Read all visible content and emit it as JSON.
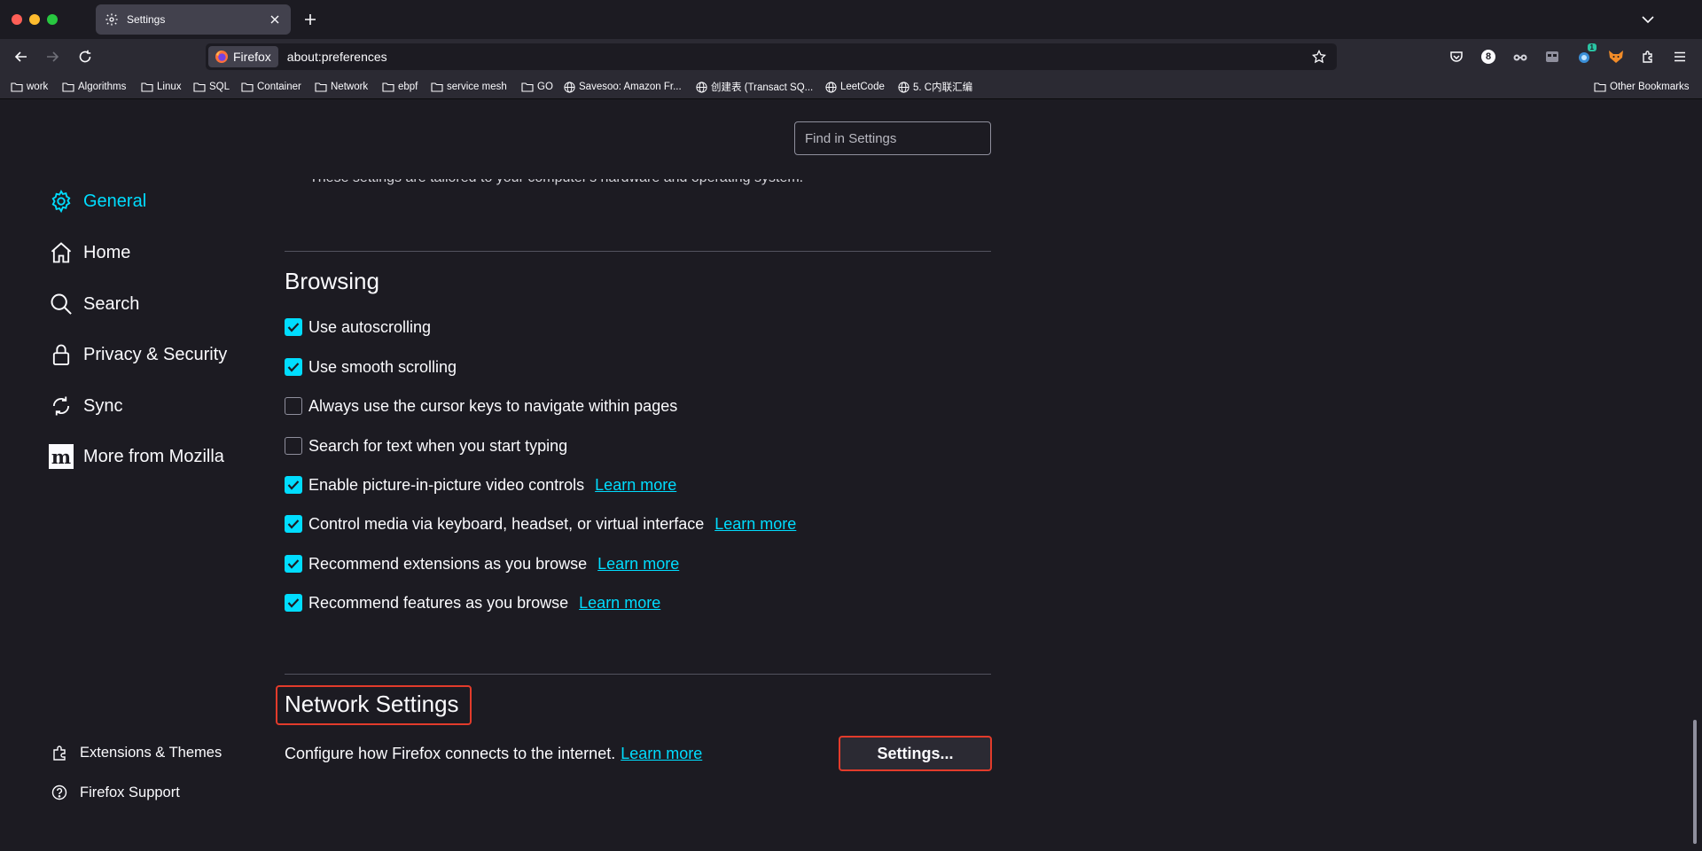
{
  "window": {
    "traffic_lights": [
      "close",
      "minimize",
      "zoom"
    ]
  },
  "tab": {
    "title": "Settings"
  },
  "urlbar": {
    "identity_label": "Firefox",
    "url": "about:preferences"
  },
  "extensions": {
    "badge_number": "8",
    "notification_count": "1"
  },
  "bookmarks": {
    "items": [
      {
        "label": "work",
        "icon": "folder-icon"
      },
      {
        "label": "Algorithms",
        "icon": "folder-icon"
      },
      {
        "label": "Linux",
        "icon": "folder-icon"
      },
      {
        "label": "SQL",
        "icon": "folder-icon"
      },
      {
        "label": "Container",
        "icon": "folder-icon"
      },
      {
        "label": "Network",
        "icon": "folder-icon"
      },
      {
        "label": "ebpf",
        "icon": "folder-icon"
      },
      {
        "label": "service mesh",
        "icon": "folder-icon"
      },
      {
        "label": "GO",
        "icon": "folder-icon"
      },
      {
        "label": "Savesoo: Amazon Fr...",
        "icon": "globe-icon"
      },
      {
        "label": "创建表 (Transact SQ...",
        "icon": "globe-icon"
      },
      {
        "label": "LeetCode",
        "icon": "globe-icon"
      },
      {
        "label": "5. C内联汇编",
        "icon": "globe-icon"
      }
    ],
    "other": "Other Bookmarks"
  },
  "search": {
    "placeholder": "Find in Settings"
  },
  "sidebar": {
    "categories": [
      {
        "label": "General",
        "icon": "gear-icon",
        "selected": true
      },
      {
        "label": "Home",
        "icon": "home-icon"
      },
      {
        "label": "Search",
        "icon": "search-icon"
      },
      {
        "label": "Privacy & Security",
        "icon": "lock-icon"
      },
      {
        "label": "Sync",
        "icon": "sync-icon"
      },
      {
        "label": "More from Mozilla",
        "icon": "mozilla-icon"
      }
    ],
    "footer": [
      {
        "label": "Extensions & Themes",
        "icon": "puzzle-icon"
      },
      {
        "label": "Firefox Support",
        "icon": "help-icon"
      }
    ]
  },
  "main": {
    "truncated_text": "These settings are tailored to your computer's hardware and operating system.",
    "browsing": {
      "title": "Browsing",
      "options": [
        {
          "label": "Use autoscrolling",
          "checked": true,
          "learn_more": ""
        },
        {
          "label": "Use smooth scrolling",
          "checked": true,
          "learn_more": ""
        },
        {
          "label": "Always use the cursor keys to navigate within pages",
          "checked": false,
          "learn_more": ""
        },
        {
          "label": "Search for text when you start typing",
          "checked": false,
          "learn_more": ""
        },
        {
          "label": "Enable picture-in-picture video controls",
          "checked": true,
          "learn_more": "Learn more"
        },
        {
          "label": "Control media via keyboard, headset, or virtual interface",
          "checked": true,
          "learn_more": "Learn more"
        },
        {
          "label": "Recommend extensions as you browse",
          "checked": true,
          "learn_more": "Learn more"
        },
        {
          "label": "Recommend features as you browse",
          "checked": true,
          "learn_more": "Learn more"
        }
      ]
    },
    "network": {
      "title": "Network Settings",
      "description": "Configure how Firefox connects to the internet.",
      "learn_more": "Learn more",
      "button": "Settings..."
    }
  },
  "colors": {
    "accent": "#00ddff",
    "highlight": "#e23b2b",
    "background": "#1c1b22",
    "toolbar": "#2b2a33"
  }
}
